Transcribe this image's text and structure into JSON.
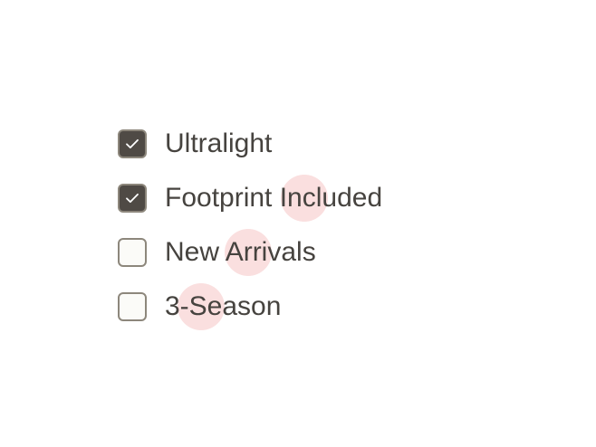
{
  "checklist": {
    "items": [
      {
        "label": "Ultralight",
        "checked": true,
        "state_icon": "check-icon"
      },
      {
        "label": "Footprint Included",
        "checked": true,
        "state_icon": "check-icon"
      },
      {
        "label": "New Arrivals",
        "checked": false,
        "state_icon": "empty-checkbox-icon"
      },
      {
        "label": "3-Season",
        "checked": false,
        "state_icon": "empty-checkbox-icon"
      }
    ]
  },
  "colors": {
    "checked_fill": "#4f4a45",
    "border": "#8d877c",
    "unchecked_fill": "#fbfbf8",
    "text": "#46433f",
    "ripple": "#fadcdc",
    "background": "#ffffff"
  }
}
